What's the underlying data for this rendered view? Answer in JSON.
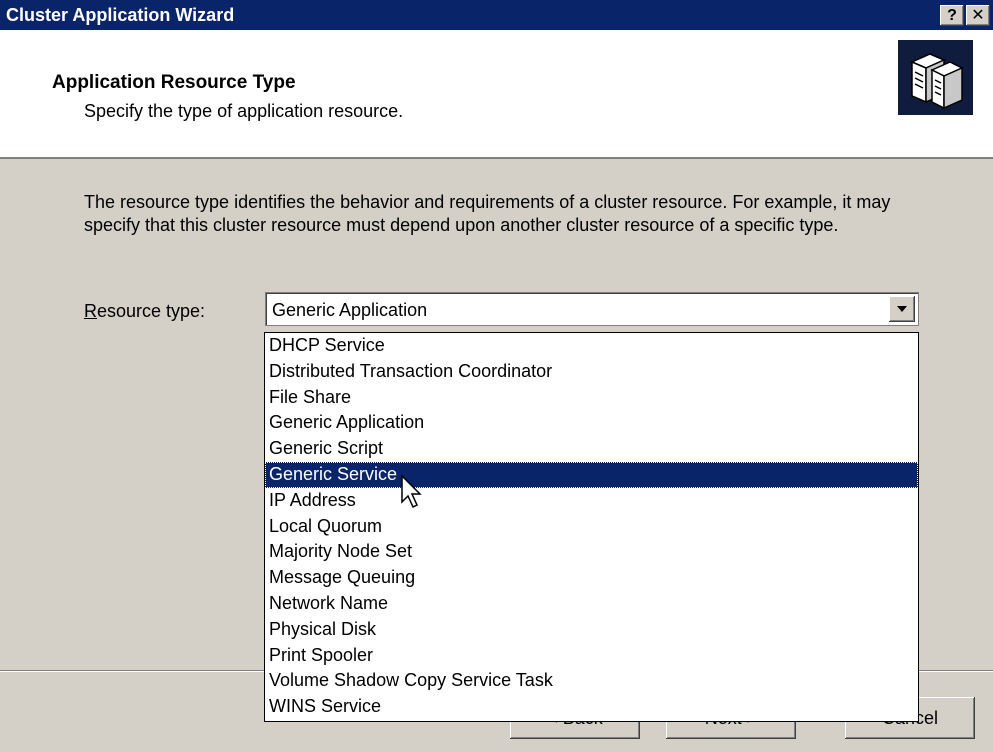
{
  "window": {
    "title": "Cluster Application Wizard",
    "help_label": "?",
    "close_label": "✕"
  },
  "header": {
    "title": "Application Resource Type",
    "subtitle": "Specify the type of application resource.",
    "icon": "servers-icon"
  },
  "body": {
    "description": "The resource type identifies the behavior and requirements of a cluster resource. For example, it may specify that this cluster resource must depend upon another cluster resource of a specific type.",
    "resource_type_label_first": "R",
    "resource_type_label_rest": "esource type:",
    "selected_value": "Generic Application"
  },
  "dropdown": {
    "items": [
      "DHCP Service",
      "Distributed Transaction Coordinator",
      "File Share",
      "Generic Application",
      "Generic Script",
      "Generic Service",
      "IP Address",
      "Local Quorum",
      "Majority Node Set",
      "Message Queuing",
      "Network Name",
      "Physical Disk",
      "Print Spooler",
      "Volume Shadow Copy Service Task",
      "WINS Service"
    ],
    "highlighted_index": 5
  },
  "buttons": {
    "back": "< Back",
    "next": "Next >",
    "cancel": "Cancel"
  },
  "colors": {
    "titlebar": "#0a246a",
    "highlight": "#0a246a",
    "face": "#d4d0c8"
  }
}
